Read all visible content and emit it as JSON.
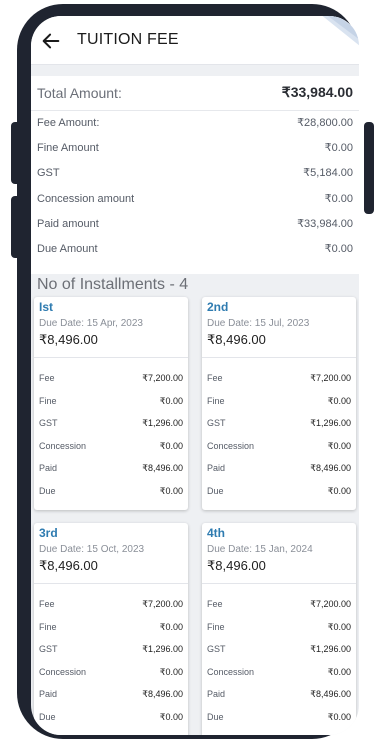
{
  "header": {
    "title": "TUITION FEE"
  },
  "summary": {
    "total_label": "Total Amount:",
    "total_value": "₹33,984.00",
    "rows": [
      {
        "label": "Fee Amount:",
        "value": "₹28,800.00"
      },
      {
        "label": "Fine Amount",
        "value": "₹0.00"
      },
      {
        "label": "GST",
        "value": "₹5,184.00"
      },
      {
        "label": "Concession amount",
        "value": "₹0.00"
      },
      {
        "label": "Paid amount",
        "value": "₹33,984.00"
      },
      {
        "label": "Due Amount",
        "value": "₹0.00"
      }
    ]
  },
  "installments_label": "No of Installments - 4",
  "installments": [
    {
      "num": "Ist",
      "due_date": "Due Date: 15 Apr, 2023",
      "amount": "₹8,496.00",
      "rows": [
        [
          "Fee",
          "₹7,200.00"
        ],
        [
          "Fine",
          "₹0.00"
        ],
        [
          "GST",
          "₹1,296.00"
        ],
        [
          "Concession",
          "₹0.00"
        ],
        [
          "Paid",
          "₹8,496.00"
        ],
        [
          "Due",
          "₹0.00"
        ]
      ]
    },
    {
      "num": "2nd",
      "due_date": "Due Date: 15 Jul, 2023",
      "amount": "₹8,496.00",
      "rows": [
        [
          "Fee",
          "₹7,200.00"
        ],
        [
          "Fine",
          "₹0.00"
        ],
        [
          "GST",
          "₹1,296.00"
        ],
        [
          "Concession",
          "₹0.00"
        ],
        [
          "Paid",
          "₹8,496.00"
        ],
        [
          "Due",
          "₹0.00"
        ]
      ]
    },
    {
      "num": "3rd",
      "due_date": "Due Date: 15 Oct, 2023",
      "amount": "₹8,496.00",
      "rows": [
        [
          "Fee",
          "₹7,200.00"
        ],
        [
          "Fine",
          "₹0.00"
        ],
        [
          "GST",
          "₹1,296.00"
        ],
        [
          "Concession",
          "₹0.00"
        ],
        [
          "Paid",
          "₹8,496.00"
        ],
        [
          "Due",
          "₹0.00"
        ]
      ]
    },
    {
      "num": "4th",
      "due_date": "Due Date: 15 Jan, 2024",
      "amount": "₹8,496.00",
      "rows": [
        [
          "Fee",
          "₹7,200.00"
        ],
        [
          "Fine",
          "₹0.00"
        ],
        [
          "GST",
          "₹1,296.00"
        ],
        [
          "Concession",
          "₹0.00"
        ],
        [
          "Paid",
          "₹8,496.00"
        ],
        [
          "Due",
          "₹0.00"
        ]
      ]
    }
  ],
  "colors": {
    "accent": "#2e7bb0",
    "frame": "#1f2430"
  },
  "icons": {
    "back": "arrow-left-icon"
  }
}
